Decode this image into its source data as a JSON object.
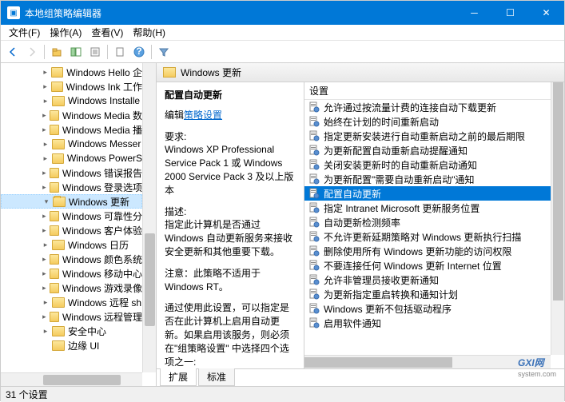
{
  "window": {
    "title": "本地组策略编辑器",
    "title_icon": "gpedit-icon"
  },
  "menubar": {
    "items": [
      {
        "label": "文件(F)",
        "name": "menu-file"
      },
      {
        "label": "操作(A)",
        "name": "menu-action"
      },
      {
        "label": "查看(V)",
        "name": "menu-view"
      },
      {
        "label": "帮助(H)",
        "name": "menu-help"
      }
    ]
  },
  "toolbar": {
    "items": [
      {
        "name": "nav-back",
        "glyph": "←"
      },
      {
        "name": "nav-forward",
        "glyph": "→"
      },
      {
        "name": "up-level",
        "glyph": "⬆"
      },
      {
        "name": "show-hide-tree",
        "glyph": "☰"
      },
      {
        "name": "properties",
        "glyph": "▤"
      },
      {
        "name": "export-list",
        "glyph": "❏"
      },
      {
        "name": "help",
        "glyph": "?"
      },
      {
        "name": "filter",
        "glyph": "▼"
      }
    ]
  },
  "tree": {
    "items": [
      {
        "label": "Windows Hello 企",
        "expandable": true,
        "open": false
      },
      {
        "label": "Windows Ink 工作",
        "expandable": true,
        "open": false
      },
      {
        "label": "Windows Installe",
        "expandable": true,
        "open": false
      },
      {
        "label": "Windows Media 数",
        "expandable": true,
        "open": false
      },
      {
        "label": "Windows Media 播",
        "expandable": true,
        "open": false
      },
      {
        "label": "Windows Messer",
        "expandable": true,
        "open": false
      },
      {
        "label": "Windows PowerS",
        "expandable": true,
        "open": false
      },
      {
        "label": "Windows 错误报告",
        "expandable": true,
        "open": false
      },
      {
        "label": "Windows 登录选项",
        "expandable": true,
        "open": false
      },
      {
        "label": "Windows 更新",
        "expandable": true,
        "open": true,
        "selected": true
      },
      {
        "label": "Windows 可靠性分",
        "expandable": true,
        "open": false
      },
      {
        "label": "Windows 客户体验",
        "expandable": true,
        "open": false
      },
      {
        "label": "Windows 日历",
        "expandable": true,
        "open": false
      },
      {
        "label": "Windows 颜色系统",
        "expandable": true,
        "open": false
      },
      {
        "label": "Windows 移动中心",
        "expandable": true,
        "open": false
      },
      {
        "label": "Windows 游戏录像",
        "expandable": true,
        "open": false
      },
      {
        "label": "Windows 远程 sh",
        "expandable": true,
        "open": false
      },
      {
        "label": "Windows 远程管理",
        "expandable": true,
        "open": false
      },
      {
        "label": "安全中心",
        "expandable": true,
        "open": false
      },
      {
        "label": "边缘 UI",
        "expandable": false,
        "open": false
      }
    ],
    "vscroll": {
      "pos": 55,
      "size": 30
    },
    "hscroll": {
      "pos": 30,
      "size": 55
    }
  },
  "right": {
    "header_icon": "folder-icon",
    "header_title": "Windows 更新",
    "detail": {
      "title": "配置自动更新",
      "edit_prefix": "编辑",
      "edit_link": "策略设置",
      "req_label": "要求:",
      "req_text": "Windows XP Professional Service Pack 1 或 Windows 2000 Service Pack 3 及以上版本",
      "desc_label": "描述:",
      "desc_text1": "指定此计算机是否通过 Windows 自动更新服务来接收安全更新和其他重要下载。",
      "desc_text2": "注意：此策略不适用于 Windows RT。",
      "desc_text3": "通过使用此设置，可以指定是否在此计算机上启用自动更新。如果启用该服务，则必须在\"组策略设置\" 中选择四个选项之一:"
    },
    "settings_header": "设置",
    "settings": [
      {
        "label": "允许通过按流量计费的连接自动下载更新"
      },
      {
        "label": "始终在计划的时间重新启动"
      },
      {
        "label": "指定更新安装进行自动重新启动之前的最后期限"
      },
      {
        "label": "为更新配置自动重新启动提醒通知"
      },
      {
        "label": "关闭安装更新时的自动重新启动通知"
      },
      {
        "label": "为更新配置\"需要自动重新启动\"通知"
      },
      {
        "label": "配置自动更新",
        "selected": true
      },
      {
        "label": "指定 Intranet Microsoft 更新服务位置"
      },
      {
        "label": "自动更新检测频率"
      },
      {
        "label": "不允许更新延期策略对 Windows 更新执行扫描"
      },
      {
        "label": "删除使用所有 Windows 更新功能的访问权限"
      },
      {
        "label": "不要连接任何 Windows 更新 Internet 位置"
      },
      {
        "label": "允许非管理员接收更新通知"
      },
      {
        "label": "为更新指定重启转换和通知计划"
      },
      {
        "label": "Windows 更新不包括驱动程序"
      },
      {
        "label": "启用软件通知"
      }
    ],
    "tabs": [
      {
        "label": "扩展",
        "active": true
      },
      {
        "label": "标准",
        "active": false
      }
    ]
  },
  "statusbar": {
    "text": "31 个设置"
  },
  "watermark": {
    "main": "GXI网",
    "sub": "system.com"
  }
}
